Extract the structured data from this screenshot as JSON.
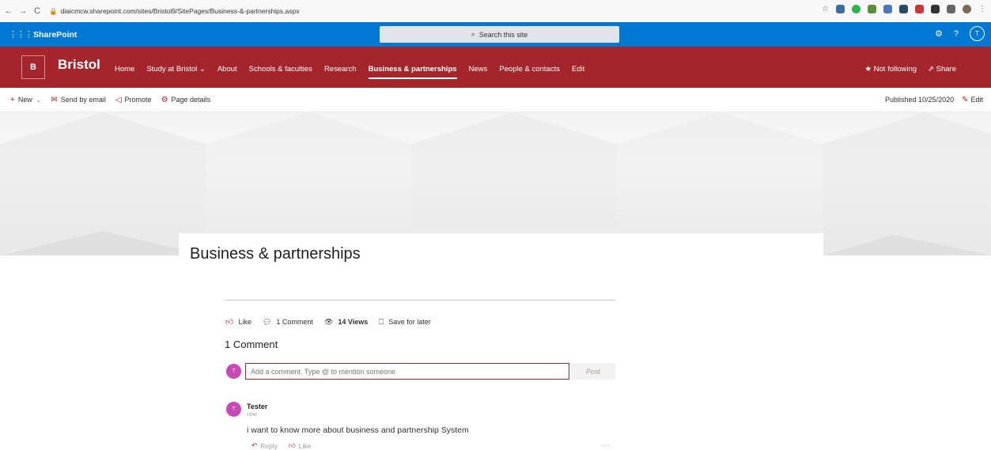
{
  "browser": {
    "url": "diaicmcw.sharepoint.com/sites/Bristol9/SitePages/Business-&-partnerships.aspx"
  },
  "suite": {
    "brand": "SharePoint",
    "search_placeholder": "Search this site",
    "help": "?",
    "avatar_initial": "T"
  },
  "site": {
    "logo_letter": "B",
    "title": "Bristol",
    "nav": [
      {
        "label": "Home"
      },
      {
        "label": "Study at Bristol"
      },
      {
        "label": "About"
      },
      {
        "label": "Schools & faculties"
      },
      {
        "label": "Research"
      },
      {
        "label": "Business & partnerships",
        "active": true
      },
      {
        "label": "News"
      },
      {
        "label": "People & contacts"
      },
      {
        "label": "Edit"
      }
    ],
    "not_following": "Not following",
    "share": "Share"
  },
  "command_bar": {
    "new": "New",
    "send_by_email": "Send by email",
    "promote": "Promote",
    "page_details": "Page details",
    "published": "Published 10/25/2020",
    "edit": "Edit"
  },
  "page": {
    "title": "Business & partnerships"
  },
  "social": {
    "like": "Like",
    "comments": "1 Comment",
    "views": "14 Views",
    "save": "Save for later"
  },
  "comments": {
    "heading": "1 Comment",
    "input_placeholder": "Add a comment. Type @ to mention someone",
    "post": "Post",
    "avatar_initial": "T",
    "items": [
      {
        "author": "Tester",
        "time": "now",
        "text": "i want to know more about business and partnership System",
        "reply": "Reply",
        "like": "Like",
        "avatar_initial": "T"
      }
    ]
  },
  "colors": {
    "suite_bar": "#0078d4",
    "theme": "#a4262c",
    "avatar": "#c948b6"
  }
}
